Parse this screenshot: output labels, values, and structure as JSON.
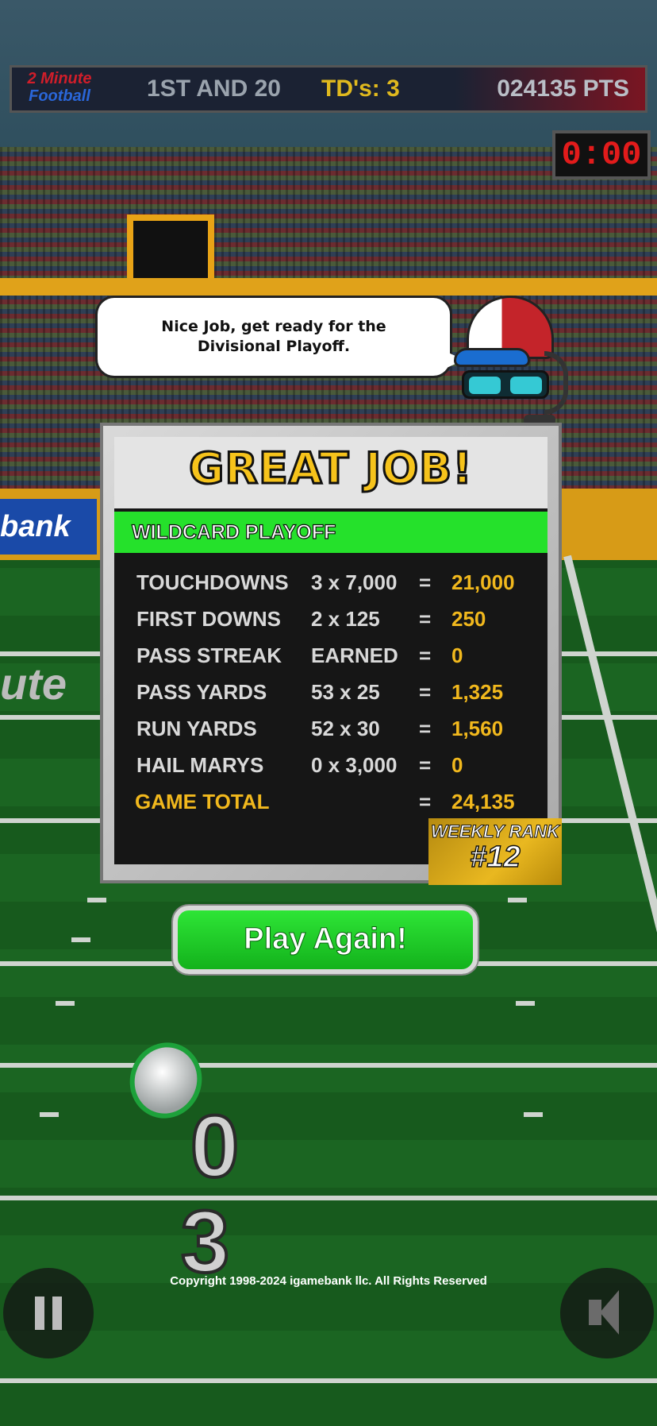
{
  "scoreboard": {
    "logo_line1": "2 Minute",
    "logo_line2": "Football",
    "down_distance": "1ST AND 20",
    "touchdowns": "TD's: 3",
    "points": "024135 PTS",
    "clock": "0:00"
  },
  "stadium": {
    "banner_text": "bank",
    "field_text": "ute",
    "field_numbers": [
      "0",
      "3"
    ]
  },
  "coach": {
    "message": "Nice Job, get ready for the Divisional Playoff."
  },
  "results": {
    "title": "GREAT JOB!",
    "round": "WILDCARD PLAYOFF",
    "rows": [
      {
        "label": "TOUCHDOWNS",
        "calc": "3 x 7,000",
        "eq": "=",
        "value": "21,000"
      },
      {
        "label": "FIRST  DOWNS",
        "calc": "2 x 125",
        "eq": "=",
        "value": "250"
      },
      {
        "label": "PASS  STREAK",
        "calc": "EARNED",
        "eq": "=",
        "value": "0"
      },
      {
        "label": "PASS  YARDS",
        "calc": "53 x 25",
        "eq": "=",
        "value": "1,325"
      },
      {
        "label": "RUN    YARDS",
        "calc": "52 x 30",
        "eq": "=",
        "value": "1,560"
      },
      {
        "label": "HAIL  MARYS",
        "calc": "0 x 3,000",
        "eq": "=",
        "value": "0"
      }
    ],
    "total": {
      "label": "GAME TOTAL",
      "eq": "=",
      "value": "24,135"
    },
    "weekly_rank_label": "WEEKLY RANK",
    "weekly_rank_value": "#12"
  },
  "actions": {
    "play_again": "Play Again!"
  },
  "footer": {
    "copyright": "Copyright 1998-2024 igamebank llc. All Rights Reserved"
  },
  "colors": {
    "accent_gold": "#f1b81d",
    "stripe_green": "#25e12b",
    "button_green": "#2ee536",
    "clock_red": "#e21b1b"
  },
  "icons": [
    "pause-icon",
    "speaker-icon"
  ]
}
